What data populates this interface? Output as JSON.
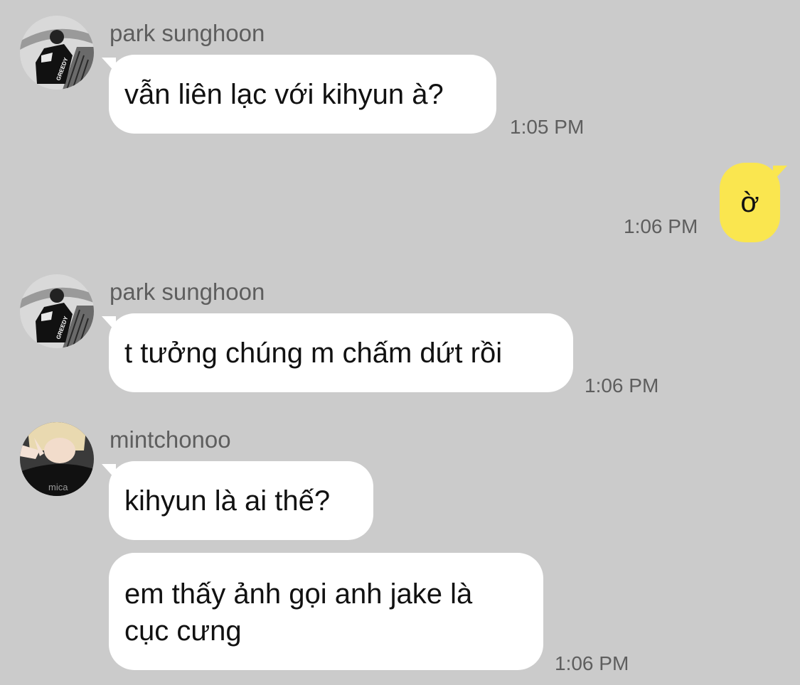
{
  "messages": [
    {
      "sender": "park sunghoon",
      "text": "vẫn liên lạc với kihyun à?",
      "time": "1:05 PM"
    },
    {
      "sender": "",
      "text": "ờ",
      "time": "1:06 PM"
    },
    {
      "sender": "park sunghoon",
      "text": "t tưởng chúng m chấm dứt rồi",
      "time": "1:06 PM"
    },
    {
      "sender": "mintchonoo",
      "text": "kihyun là ai thế?",
      "time": ""
    },
    {
      "sender": "mintchonoo",
      "text": "em thấy ảnh gọi anh jake là cục cưng",
      "time": "1:06 PM"
    }
  ],
  "avatar_texts": {
    "sunghoon_shirt": "GREEDY",
    "mintchonoo_shirt": "mica"
  },
  "colors": {
    "background": "#cbcbcb",
    "incoming_bubble": "#ffffff",
    "outgoing_bubble": "#fae64f",
    "meta_text": "#5e5e5e"
  }
}
